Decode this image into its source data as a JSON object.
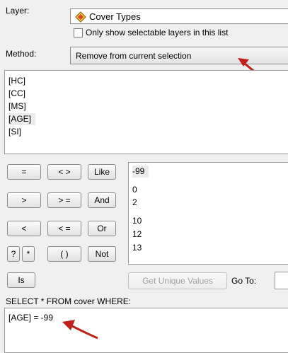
{
  "layer": {
    "label": "Layer:",
    "value": "Cover Types",
    "icon": "diamond-layer-icon",
    "checkbox_label": "Only show selectable layers in this list"
  },
  "method": {
    "label": "Method:",
    "value": "Remove from current selection"
  },
  "fields": [
    "[HC]",
    "[CC]",
    "[MS]",
    "[AGE]",
    "[SI]"
  ],
  "operators": {
    "eq": "=",
    "neq": "< >",
    "like": "Like",
    "gt": ">",
    "gte": "> =",
    "and": "And",
    "lt": "<",
    "lte": "< =",
    "or": "Or",
    "q": "?",
    "star": "*",
    "paren": "( )",
    "not": "Not",
    "is": "Is"
  },
  "values": [
    "-99",
    "0",
    "2",
    "10",
    "12",
    "13"
  ],
  "get_unique_values": "Get Unique Values",
  "goto_label": "Go To:",
  "query_prefix": "SELECT * FROM cover WHERE:",
  "query_text": "[AGE] = -99",
  "colors": {
    "annotation_arrow": "#c0201a"
  }
}
